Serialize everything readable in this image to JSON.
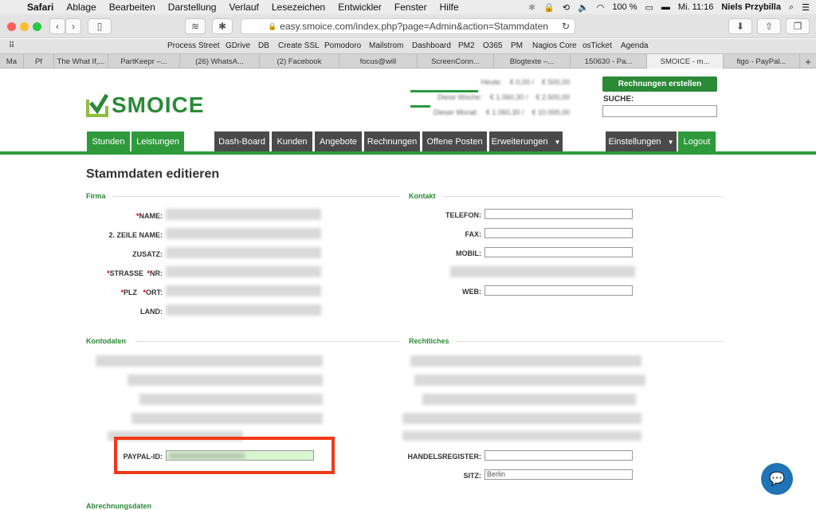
{
  "menubar": {
    "items": [
      "Safari",
      "Ablage",
      "Bearbeiten",
      "Darstellung",
      "Verlauf",
      "Lesezeichen",
      "Entwickler",
      "Fenster",
      "Hilfe"
    ],
    "battery": "100 %",
    "clock": "Mi. 11:16",
    "user": "Niels Przybilla"
  },
  "toolbar": {
    "url": "easy.smoice.com/index.php?page=Admin&action=Stammdaten"
  },
  "bookmarks": [
    "Process Street",
    "GDrive",
    "DB",
    "Create SSL",
    "Pomodoro",
    "Mailstrom",
    "Dashboard",
    "PM2",
    "O365",
    "PM",
    "Nagios Core",
    "osTicket",
    "Agenda"
  ],
  "tabs": [
    "Ma",
    "Pf",
    "The What If,...",
    "PartKeepr –...",
    "(26) WhatsA...",
    "(2) Facebook",
    "focus@will",
    "ScreenConn...",
    "Blogtexte –...",
    "150630 - Pa...",
    "SMOICE - m...",
    "figo - PayPal..."
  ],
  "active_tab_index": 10,
  "header": {
    "logo_text": "SMOICE",
    "create_invoice_label": "Rechnungen erstellen",
    "search_label": "SUCHE:",
    "stats": [
      {
        "label": "Heute:",
        "v1": "€ 0,00 /",
        "v2": "€ 500,00"
      },
      {
        "label": "Diese Woche:",
        "v1": "€ 1.060,30 /",
        "v2": "€ 2.500,00"
      },
      {
        "label": "Dieser Monat:",
        "v1": "€ 1.060,30 /",
        "v2": "€ 10.000,00"
      }
    ]
  },
  "nav": {
    "left": [
      "Stunden",
      "Leistungen"
    ],
    "middle": [
      "Dash-Board",
      "Kunden",
      "Angebote",
      "Rechnungen",
      "Offene Posten",
      "Erweiterungen"
    ],
    "right": [
      "Einstellungen",
      "Logout"
    ]
  },
  "page": {
    "title": "Stammdaten editieren",
    "sections": {
      "firma": "Firma",
      "kontakt": "Kontakt",
      "kontodaten": "Kontodaten",
      "rechtliches": "Rechtliches",
      "abrechnungsdaten": "Abrechnungsdaten"
    },
    "firma_labels": [
      "NAME:",
      "2. ZEILE NAME:",
      "ZUSATZ:",
      "STRASSE",
      "NR:",
      "PLZ",
      "ORT:",
      "LAND:"
    ],
    "kontakt_labels": [
      "TELEFON:",
      "FAX:",
      "MOBIL:",
      "WEB:"
    ],
    "paypal_label": "PAYPAL-ID:",
    "handelsregister_label": "HANDELSREGISTER:",
    "sitz_label": "SITZ:",
    "sitz_value": "Berlin"
  },
  "colors": {
    "brand_green": "#2e9a3b",
    "nav_dark": "#4a4a4a",
    "highlight": "#f03a17",
    "chat_blue": "#1f73b7"
  }
}
